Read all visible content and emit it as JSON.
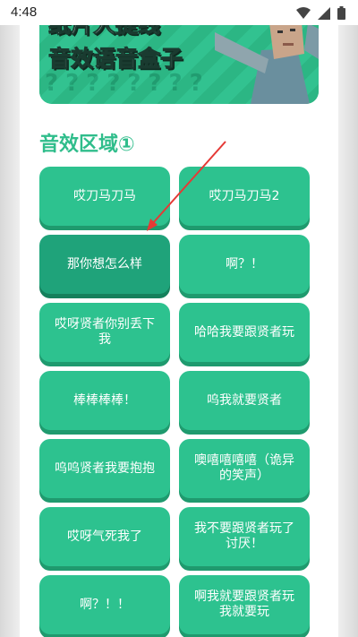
{
  "status_bar": {
    "time": "4:48",
    "icons": [
      "wifi-icon",
      "signal-icon",
      "battery-icon"
    ]
  },
  "banner": {
    "line1": "纸片人提线",
    "line2": "音效语音盒子",
    "pattern": "????????"
  },
  "section": {
    "title": "音效区域①"
  },
  "colors": {
    "accent": "#2dc28f",
    "accent_dark": "#1f9a6e",
    "pressed": "#1fa37a",
    "arrow": "#e53935"
  },
  "buttons": [
    {
      "label": "哎刀马刀马",
      "pressed": false
    },
    {
      "label": "哎刀马刀马2",
      "pressed": false
    },
    {
      "label": "那你想怎么样",
      "pressed": true
    },
    {
      "label": "啊？！",
      "pressed": false
    },
    {
      "label": "哎呀贤者你别丢下我",
      "pressed": false
    },
    {
      "label": "哈哈我要跟贤者玩",
      "pressed": false
    },
    {
      "label": "棒棒棒棒！",
      "pressed": false
    },
    {
      "label": "呜我就要贤者",
      "pressed": false
    },
    {
      "label": "呜呜贤者我要抱抱",
      "pressed": false
    },
    {
      "label": "噢嘻嘻嘻嘻（诡异的笑声）",
      "pressed": false
    },
    {
      "label": "哎呀气死我了",
      "pressed": false
    },
    {
      "label": "我不要跟贤者玩了讨厌！",
      "pressed": false
    },
    {
      "label": "啊？！！",
      "pressed": false
    },
    {
      "label": "啊我就要跟贤者玩我就要玩",
      "pressed": false
    }
  ]
}
